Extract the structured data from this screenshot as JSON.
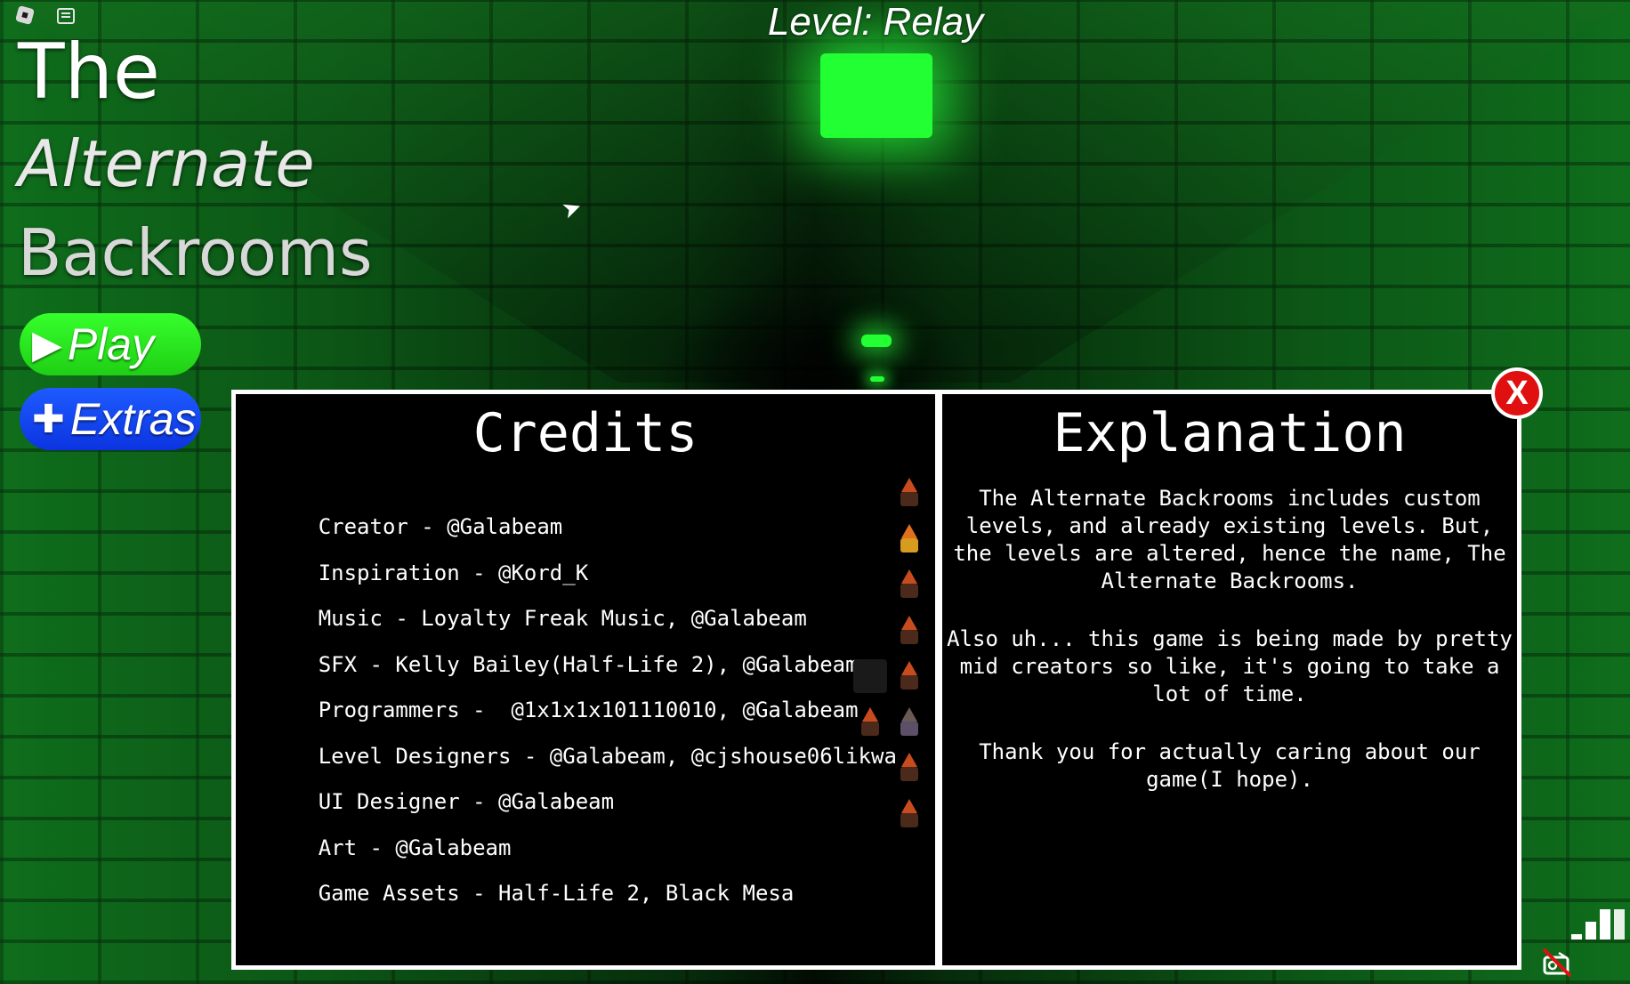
{
  "level": {
    "label": "Level: Relay"
  },
  "title": {
    "line1": "The",
    "line2": "Alternate",
    "line3": "Backrooms"
  },
  "menu": {
    "play_label": "Play",
    "extras_label": "Extras"
  },
  "credits": {
    "heading": "Credits",
    "rows": [
      {
        "text": "Creator - @Galabeam"
      },
      {
        "text": "Inspiration - @Kord_K"
      },
      {
        "text": "Music - Loyalty Freak Music, @Galabeam"
      },
      {
        "text": "SFX - Kelly Bailey(Half-Life 2), @Galabeam"
      },
      {
        "text": "Programmers -  @1x1x1x101110010, @Galabeam"
      },
      {
        "text": "Level Designers - @Galabeam, @cjshouse06likwa"
      },
      {
        "text": "UI Designer - @Galabeam"
      },
      {
        "text": "Art - @Galabeam"
      },
      {
        "text": "Game Assets - Half-Life 2, Black Mesa"
      }
    ]
  },
  "explanation": {
    "heading": "Explanation",
    "paragraph1": "The Alternate Backrooms includes custom levels, and already existing levels. But, the levels are altered, hence the name, The Alternate Backrooms.",
    "paragraph2": "Also uh... this game is being made by pretty mid creators so like, it's going to take a lot of time.",
    "paragraph3": "Thank you for actually caring about our game(I hope)."
  },
  "close_button": {
    "label": "X"
  },
  "colors": {
    "play": "#1fcf14",
    "extras": "#0b34e0",
    "close": "#e01010",
    "scene": "#0c5616"
  }
}
